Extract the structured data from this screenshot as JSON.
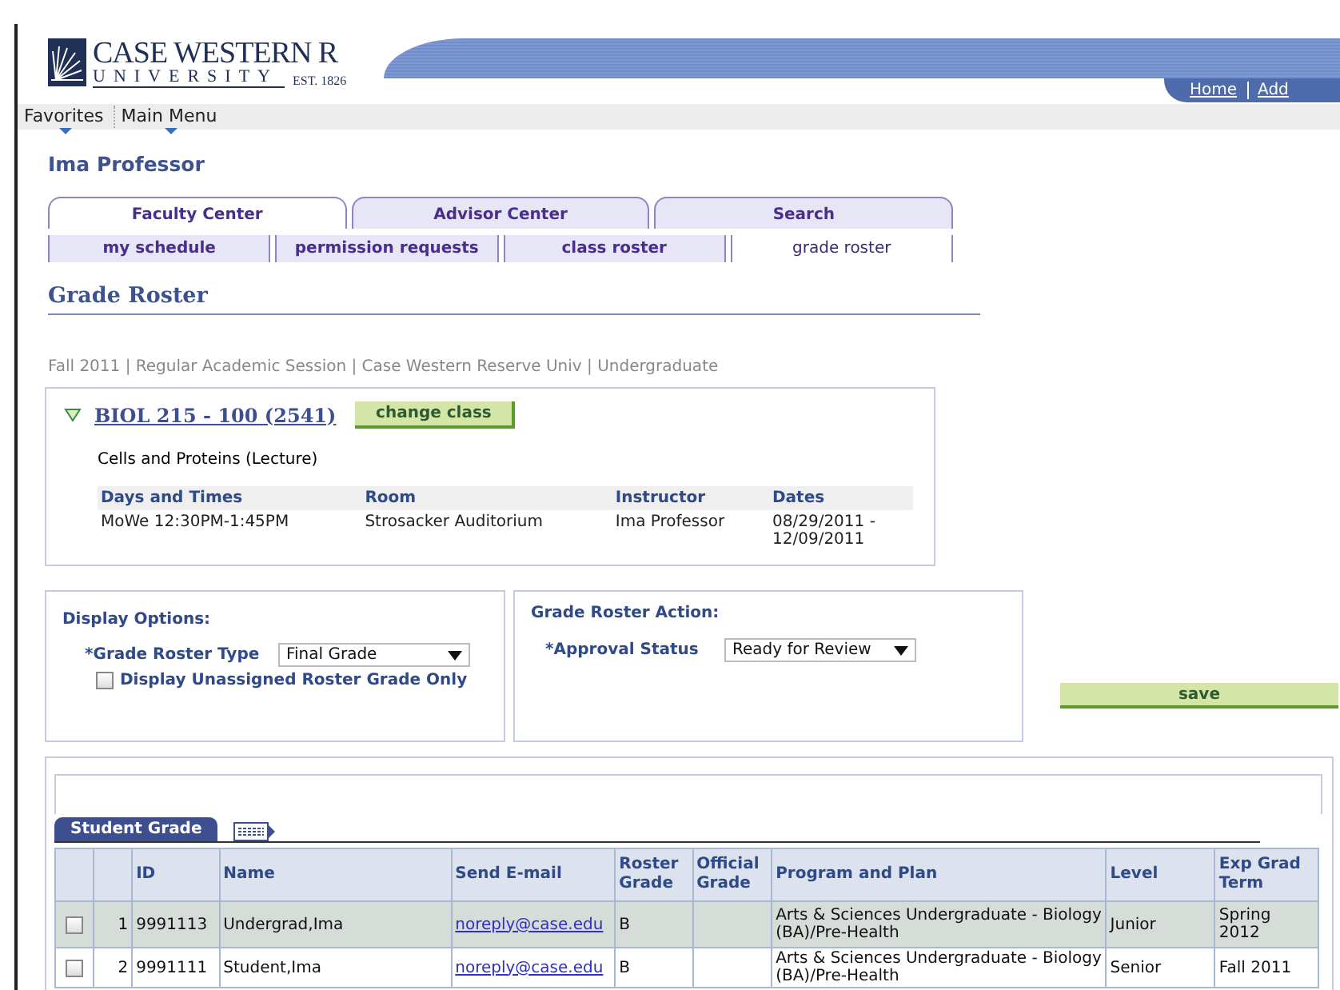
{
  "header": {
    "logo": {
      "name": "CASE WESTERN R",
      "sub": "UNIVERSITY",
      "est": "EST. 1826"
    },
    "links": [
      "Home",
      "Add"
    ]
  },
  "menu": [
    "Favorites",
    "Main Menu"
  ],
  "user": "Ima Professor",
  "tabs": [
    {
      "label": "Faculty Center",
      "selected": true
    },
    {
      "label": "Advisor Center",
      "selected": false
    },
    {
      "label": "Search",
      "selected": false
    }
  ],
  "subtabs": [
    {
      "label": "my schedule",
      "selected": false
    },
    {
      "label": "permission requests",
      "selected": false
    },
    {
      "label": "class roster",
      "selected": false
    },
    {
      "label": "grade roster",
      "selected": true
    }
  ],
  "page_title": "Grade Roster",
  "term_line": "Fall 2011 | Regular Academic Session | Case Western Reserve Univ | Undergraduate",
  "class_section": {
    "expanded": true,
    "title": "BIOL 215 - 100 (2541)",
    "button": "change class",
    "description": "Cells and Proteins (Lecture)",
    "columns": [
      "Days and Times",
      "Room",
      "Instructor",
      "Dates"
    ],
    "rows": [
      [
        "MoWe 12:30PM-1:45PM",
        "Strosacker Auditorium",
        "Ima Professor",
        "08/29/2011 - 12/09/2011"
      ]
    ]
  },
  "display_options": {
    "heading": "Display Options:",
    "roster_type": {
      "label": "*Grade Roster Type",
      "value": "Final Grade"
    },
    "unassigned": {
      "label": "Display Unassigned Roster Grade Only",
      "checked": false
    }
  },
  "roster_action": {
    "heading": "Grade Roster Action:",
    "approval": {
      "label": "*Approval Status",
      "value": "Ready for Review"
    }
  },
  "save_button": "save",
  "grid": {
    "tabs": [
      {
        "label": "Student Grade",
        "selected": true
      }
    ],
    "columns": [
      "ID",
      "Name",
      "Send E-mail",
      "Roster Grade",
      "Official Grade",
      "Program and Plan",
      "Level",
      "Exp Grad Term"
    ],
    "rows": [
      {
        "selected": true,
        "checked": false,
        "number": "1",
        "id": "9991113",
        "name": "Undergrad,Ima",
        "email": "noreply@case.edu",
        "roster_grade": "B",
        "official_grade": "",
        "program": "Arts & Sciences Undergraduate - Biology (BA)/Pre-Health",
        "level": "Junior",
        "exp_grad_term": "Spring 2012"
      },
      {
        "selected": false,
        "checked": false,
        "number": "2",
        "id": "9991111",
        "name": "Student,Ima",
        "email": "noreply@case.edu",
        "roster_grade": "B",
        "official_grade": "",
        "program": "Arts & Sciences Undergraduate - Biology (BA)/Pre-Health",
        "level": "Senior",
        "exp_grad_term": "Fall 2011"
      }
    ]
  }
}
